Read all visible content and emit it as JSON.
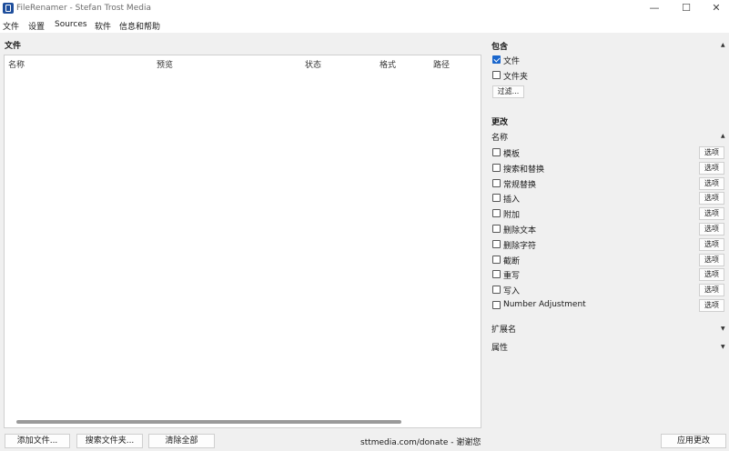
{
  "window": {
    "title": "FileRenamer - Stefan Trost Media"
  },
  "menu": [
    "文件",
    "设置",
    "Sources",
    "软件",
    "信息和帮助"
  ],
  "files": {
    "title": "文件",
    "columns": [
      "名称",
      "预览",
      "状态",
      "格式",
      "路径"
    ]
  },
  "bottom": {
    "add_files": "添加文件...",
    "search_folder": "搜索文件夹...",
    "clear_all": "清除全部",
    "donate": "sttmedia.com/donate - 谢谢您",
    "apply": "应用更改"
  },
  "include": {
    "title": "包含",
    "files_label": "文件",
    "files_checked": true,
    "folders_label": "文件夹",
    "folders_checked": false,
    "filter_button": "过滤..."
  },
  "changes": {
    "title": "更改",
    "name_section": "名称",
    "option_label": "选项",
    "items": [
      "模板",
      "搜索和替换",
      "常规替换",
      "插入",
      "附加",
      "删除文本",
      "删除字符",
      "截断",
      "重写",
      "写入",
      "Number Adjustment"
    ],
    "extension_section": "扩展名",
    "attributes_section": "属性"
  }
}
